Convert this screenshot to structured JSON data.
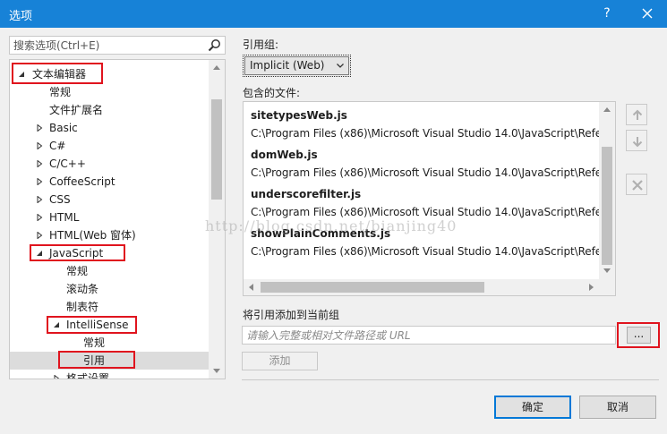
{
  "window": {
    "title": "选项",
    "help_label": "?"
  },
  "search": {
    "placeholder": "搜索选项(Ctrl+E)"
  },
  "tree": {
    "items": [
      {
        "label": "文本编辑器",
        "arrow": "expanded"
      },
      {
        "label": "常规"
      },
      {
        "label": "文件扩展名"
      },
      {
        "label": "Basic",
        "arrow": "collapsed"
      },
      {
        "label": "C#",
        "arrow": "collapsed"
      },
      {
        "label": "C/C++",
        "arrow": "collapsed"
      },
      {
        "label": "CoffeeScript",
        "arrow": "collapsed"
      },
      {
        "label": "CSS",
        "arrow": "collapsed"
      },
      {
        "label": "HTML",
        "arrow": "collapsed"
      },
      {
        "label": "HTML(Web 窗体)",
        "arrow": "collapsed"
      },
      {
        "label": "JavaScript",
        "arrow": "expanded"
      },
      {
        "label": "常规"
      },
      {
        "label": "滚动条"
      },
      {
        "label": "制表符"
      },
      {
        "label": "IntelliSense",
        "arrow": "expanded"
      },
      {
        "label": "常规"
      },
      {
        "label": "引用",
        "selected": true
      },
      {
        "label": "格式设置",
        "arrow": "collapsed"
      }
    ]
  },
  "reference_group": {
    "label": "引用组:",
    "selected": "Implicit (Web)"
  },
  "included_files": {
    "label": "包含的文件:",
    "files": [
      {
        "name": "sitetypesWeb.js",
        "path": "C:\\Program Files (x86)\\Microsoft Visual Studio 14.0\\JavaScript\\Refe"
      },
      {
        "name": "domWeb.js",
        "path": "C:\\Program Files (x86)\\Microsoft Visual Studio 14.0\\JavaScript\\Refe"
      },
      {
        "name": "underscorefilter.js",
        "path": "C:\\Program Files (x86)\\Microsoft Visual Studio 14.0\\JavaScript\\Refe"
      },
      {
        "name": "showPlainComments.js",
        "path": "C:\\Program Files (x86)\\Microsoft Visual Studio 14.0\\JavaScript\\Refe"
      }
    ]
  },
  "add_reference": {
    "label": "将引用添加到当前组",
    "placeholder": "请输入完整或相对文件路径或 URL",
    "browse_label": "...",
    "add_label": "添加"
  },
  "buttons": {
    "ok": "确定",
    "cancel": "取消"
  },
  "watermark": "http://blog.csdn.net/bianjing40",
  "colors": {
    "titlebar": "#1782d7",
    "highlight_box": "#e0141e",
    "ok_border": "#0078d7"
  }
}
